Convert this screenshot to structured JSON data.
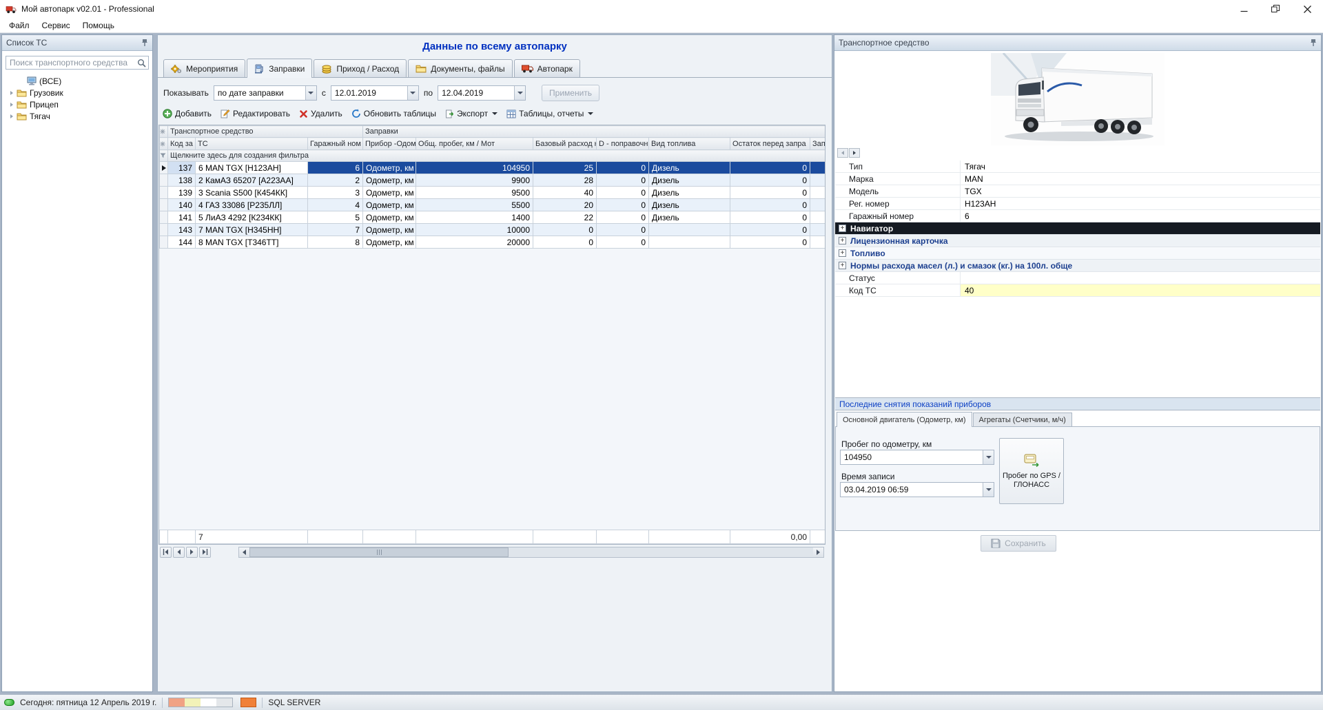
{
  "window": {
    "title": "Мой автопарк v02.01 - Professional"
  },
  "menu": {
    "items": [
      "Файл",
      "Сервис",
      "Помощь"
    ]
  },
  "sidebar": {
    "title": "Список ТС",
    "search_placeholder": "Поиск транспортного средства",
    "root_item": "(ВСЕ)",
    "tree": [
      {
        "label": "Грузовик"
      },
      {
        "label": "Прицеп"
      },
      {
        "label": "Тягач"
      }
    ]
  },
  "main": {
    "title": "Данные по всему автопарку",
    "tabs": [
      {
        "label": "Мероприятия"
      },
      {
        "label": "Заправки",
        "active": true
      },
      {
        "label": "Приход / Расход"
      },
      {
        "label": "Документы, файлы"
      },
      {
        "label": "Автопарк"
      }
    ],
    "filter": {
      "show_label": "Показывать",
      "show_value": "по дате заправки",
      "from_label": "с",
      "from_value": "12.01.2019",
      "to_label": "по",
      "to_value": "12.04.2019",
      "apply_label": "Применить"
    },
    "toolbar": [
      "Добавить",
      "Редактировать",
      "Удалить",
      "Обновить таблицы",
      "Экспорт",
      "Таблицы, отчеты"
    ],
    "table": {
      "group_headers": [
        "Транспортное средство",
        "Заправки"
      ],
      "columns": [
        "Код за",
        "ТС",
        "Гаражный ном",
        "Прибор -Одометр, км",
        "Общ. пробег, км / Мот",
        "Базовый расход н",
        "D - поправочн",
        "Вид топлива",
        "Остаток перед запра",
        "Запр"
      ],
      "filter_hint": "Щелкните здесь для создания фильтра",
      "rows": [
        {
          "code": "137",
          "ts": "6 MAN TGX [Н123АН]",
          "garage": "6",
          "device": "Одометр, км",
          "mileage": "104950",
          "base_rate": "25",
          "d_corr": "0",
          "fuel": "Дизель",
          "rest": "0",
          "zapr": "",
          "selected": true
        },
        {
          "code": "138",
          "ts": "2 КамАЗ 65207 [А223АА]",
          "garage": "2",
          "device": "Одометр, км",
          "mileage": "9900",
          "base_rate": "28",
          "d_corr": "0",
          "fuel": "Дизель",
          "rest": "0",
          "zapr": ""
        },
        {
          "code": "139",
          "ts": "3 Scania S500 [К454КК]",
          "garage": "3",
          "device": "Одометр, км",
          "mileage": "9500",
          "base_rate": "40",
          "d_corr": "0",
          "fuel": "Дизель",
          "rest": "0",
          "zapr": ""
        },
        {
          "code": "140",
          "ts": "4 ГАЗ 33086 [Р235ЛЛ]",
          "garage": "4",
          "device": "Одометр, км",
          "mileage": "5500",
          "base_rate": "20",
          "d_corr": "0",
          "fuel": "Дизель",
          "rest": "0",
          "zapr": ""
        },
        {
          "code": "141",
          "ts": "5 ЛиАЗ 4292 [К234КК]",
          "garage": "5",
          "device": "Одометр, км",
          "mileage": "1400",
          "base_rate": "22",
          "d_corr": "0",
          "fuel": "Дизель",
          "rest": "0",
          "zapr": ""
        },
        {
          "code": "143",
          "ts": "7 MAN TGX [Н345НН]",
          "garage": "7",
          "device": "Одометр, км",
          "mileage": "10000",
          "base_rate": "0",
          "d_corr": "0",
          "fuel": "",
          "rest": "0",
          "zapr": ""
        },
        {
          "code": "144",
          "ts": "8 MAN TGX [Т346ТТ]",
          "garage": "8",
          "device": "Одометр, км",
          "mileage": "20000",
          "base_rate": "0",
          "d_corr": "0",
          "fuel": "",
          "rest": "0",
          "zapr": ""
        }
      ],
      "footer": {
        "count": "7",
        "total": "0,00"
      }
    }
  },
  "vehicle": {
    "panel_title": "Транспортное средство",
    "properties": [
      {
        "label": "Тип",
        "value": "Тягач"
      },
      {
        "label": "Марка",
        "value": "MAN"
      },
      {
        "label": "Модель",
        "value": "TGX"
      },
      {
        "label": "Рег. номер",
        "value": "Н123АН"
      },
      {
        "label": "Гаражный номер",
        "value": "6"
      }
    ],
    "groups": [
      "Навигатор",
      "Лицензионная карточка",
      "Топливо",
      "Нормы расхода масел (л.) и смазок (кг.) на 100л. обще"
    ],
    "status_label": "Статус",
    "status_value": "",
    "code_label": "Код ТС",
    "code_value": "40"
  },
  "readings": {
    "section_title": "Последние снятия показаний приборов",
    "tabs": [
      {
        "label": "Основной двигатель (Одометр, км)",
        "active": true
      },
      {
        "label": "Агрегаты (Счетчики, м/ч)"
      }
    ],
    "odometer_label": "Пробег по одометру, км",
    "odometer_value": "104950",
    "time_label": "Время записи",
    "time_value": "03.04.2019 06:59",
    "gps_button_label": "Пробег по GPS / ГЛОНАСС",
    "save_label": "Сохранить"
  },
  "statusbar": {
    "today": "Сегодня: пятница 12 Апрель 2019 г.",
    "db": "SQL SERVER"
  },
  "colors": {
    "selection_blue": "#1b4b9e",
    "accent_blue": "#0030c0",
    "highlight_yellow": "#ffffc8"
  }
}
